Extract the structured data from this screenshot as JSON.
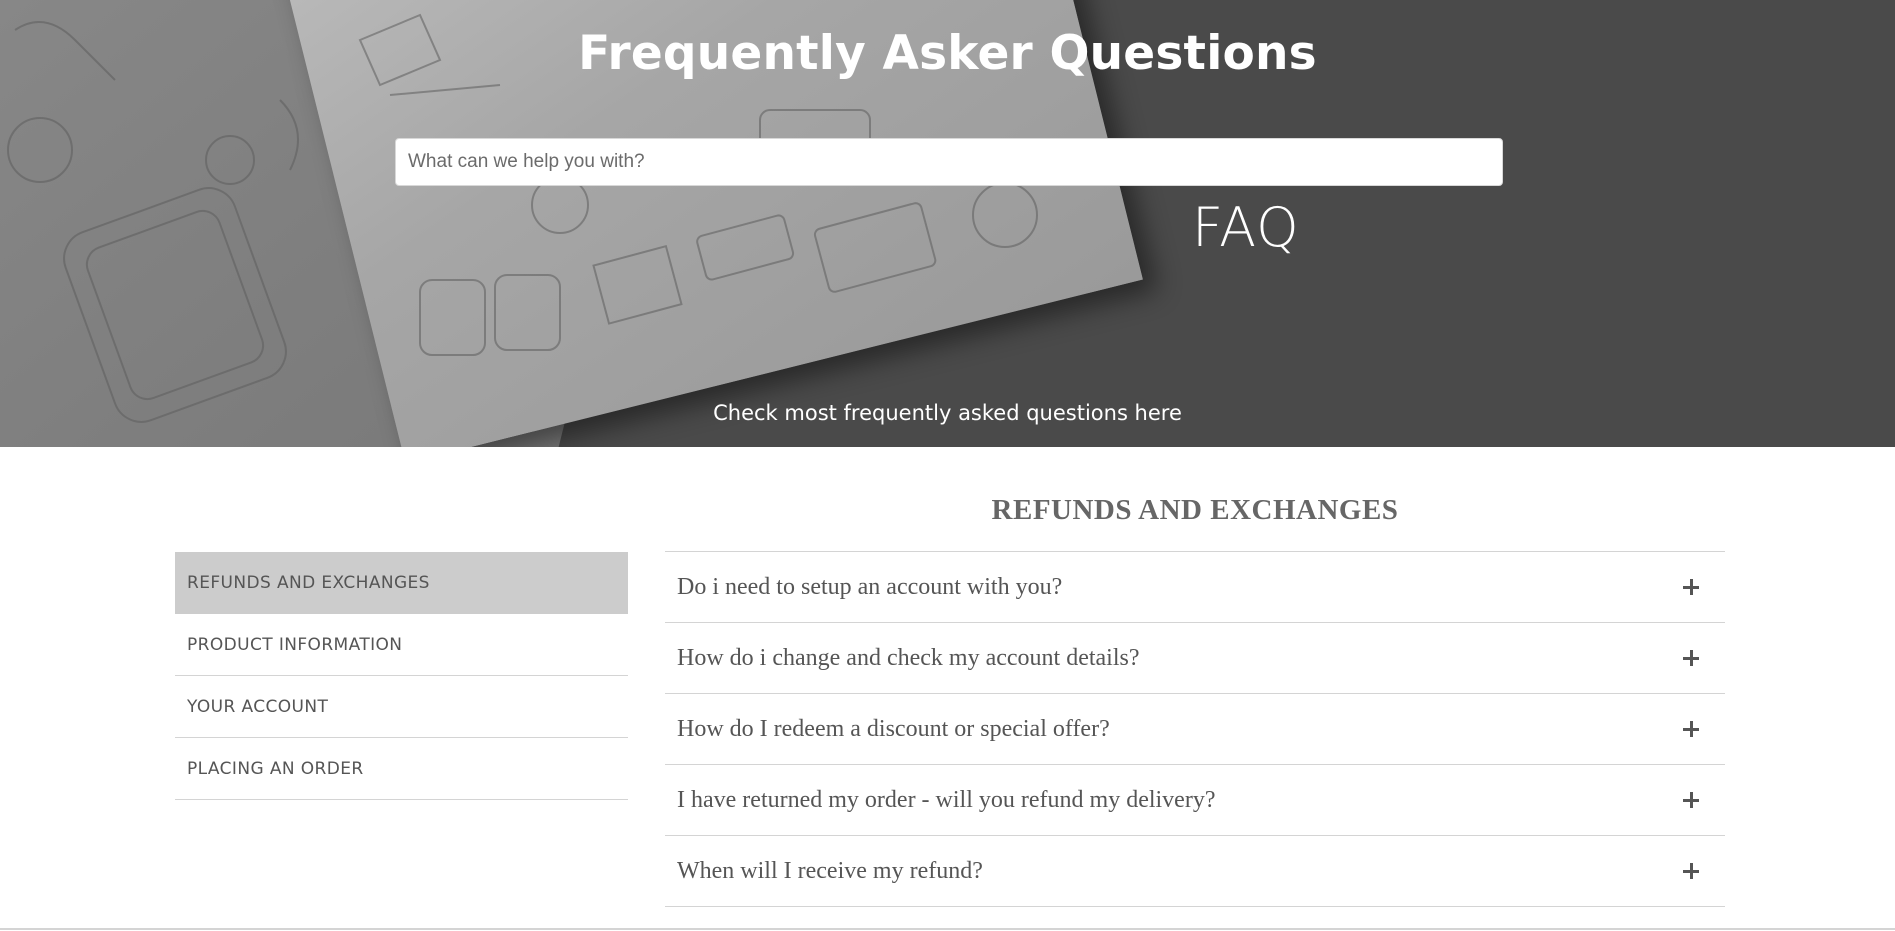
{
  "hero": {
    "title": "Frequently Asker Questions",
    "search_placeholder": "What can we help you with?",
    "badge": "FAQ",
    "subtitle": "Check most frequently asked questions here"
  },
  "section": {
    "title": "REFUNDS AND EXCHANGES"
  },
  "sidebar": {
    "items": [
      {
        "label": "REFUNDS AND EXCHANGES",
        "active": true
      },
      {
        "label": "PRODUCT INFORMATION",
        "active": false
      },
      {
        "label": "YOUR ACCOUNT",
        "active": false
      },
      {
        "label": "PLACING AN ORDER",
        "active": false
      }
    ]
  },
  "faq": {
    "items": [
      {
        "question": "Do i need to setup an account with you?",
        "icon": "plus-icon"
      },
      {
        "question": "How do i change and check my account details?",
        "icon": "plus-icon"
      },
      {
        "question": "How do I redeem a discount or special offer?",
        "icon": "plus-icon"
      },
      {
        "question": "I have returned my order - will you refund my delivery?",
        "icon": "plus-icon"
      },
      {
        "question": "When will I receive my refund?",
        "icon": "plus-icon"
      }
    ]
  },
  "colors": {
    "hero_bg": "#4a4a4a",
    "active_tab": "#cccccc",
    "text": "#555555"
  }
}
